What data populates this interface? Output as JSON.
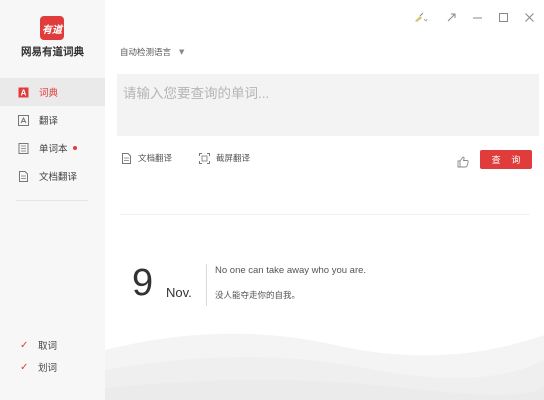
{
  "app": {
    "logo_text": "有道",
    "name": "网易有道词典"
  },
  "sidebar": {
    "items": [
      {
        "label": "词典",
        "icon": "dictionary-icon",
        "active": true
      },
      {
        "label": "翻译",
        "icon": "translate-icon",
        "active": false
      },
      {
        "label": "单词本",
        "icon": "wordbook-icon",
        "active": false,
        "badge_dot": true
      },
      {
        "label": "文档翻译",
        "icon": "document-icon",
        "active": false
      }
    ],
    "checks": [
      {
        "label": "取词",
        "checked": true
      },
      {
        "label": "划词",
        "checked": true
      }
    ]
  },
  "window_controls": [
    "skin-icon",
    "dropdown-icon",
    "mini-mode-icon",
    "minimize-icon",
    "maximize-icon",
    "close-icon"
  ],
  "main": {
    "language_select": "自动检测语言",
    "search_placeholder": "请输入您要查询的单词...",
    "search_value": "",
    "tools": {
      "doc_translate": "文档翻译",
      "screenshot_translate": "截屏翻译"
    },
    "query_button": "查 询",
    "daily": {
      "day": "9",
      "month": "Nov.",
      "quote_en": "No one can take away who you are.",
      "quote_zh": "没人能夺走你的自我。"
    }
  },
  "colors": {
    "accent": "#e03c3c",
    "sidebar_bg": "#f7f7f7",
    "input_bg": "#f3f3f3"
  }
}
